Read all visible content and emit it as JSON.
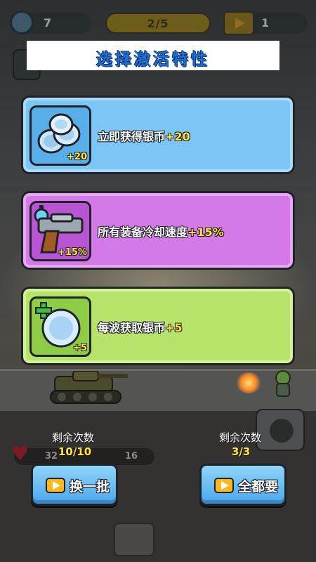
{
  "hud": {
    "coin_value": "7",
    "wave_progress": "2/5",
    "ad_value": "1"
  },
  "title": "选择激活特性",
  "cards": [
    {
      "text": "立即获得银币",
      "bonus": "+20",
      "icon": "silver-coins-icon",
      "badge": "+20",
      "color": "#7cc5f4"
    },
    {
      "text": "所有装备冷却速度",
      "bonus": "+15%",
      "icon": "stopwatch-gun-icon",
      "badge": "+15%",
      "color": "#d37ae8"
    },
    {
      "text": "每波获取银币",
      "bonus": "+5",
      "icon": "coin-plus-icon",
      "badge": "+5",
      "color": "#b7e36a"
    }
  ],
  "player": {
    "hp_left": "32",
    "hp_right": "16"
  },
  "refresh": {
    "label": "剩余次数",
    "count": "10/10",
    "button_label": "换一批"
  },
  "take_all": {
    "label": "剩余次数",
    "count": "3/3",
    "button_label": "全都要"
  },
  "colors": {
    "button_blue": "#4aa7ea",
    "bonus_yellow": "#ffe23c",
    "title_blue": "#1f6fd0"
  }
}
